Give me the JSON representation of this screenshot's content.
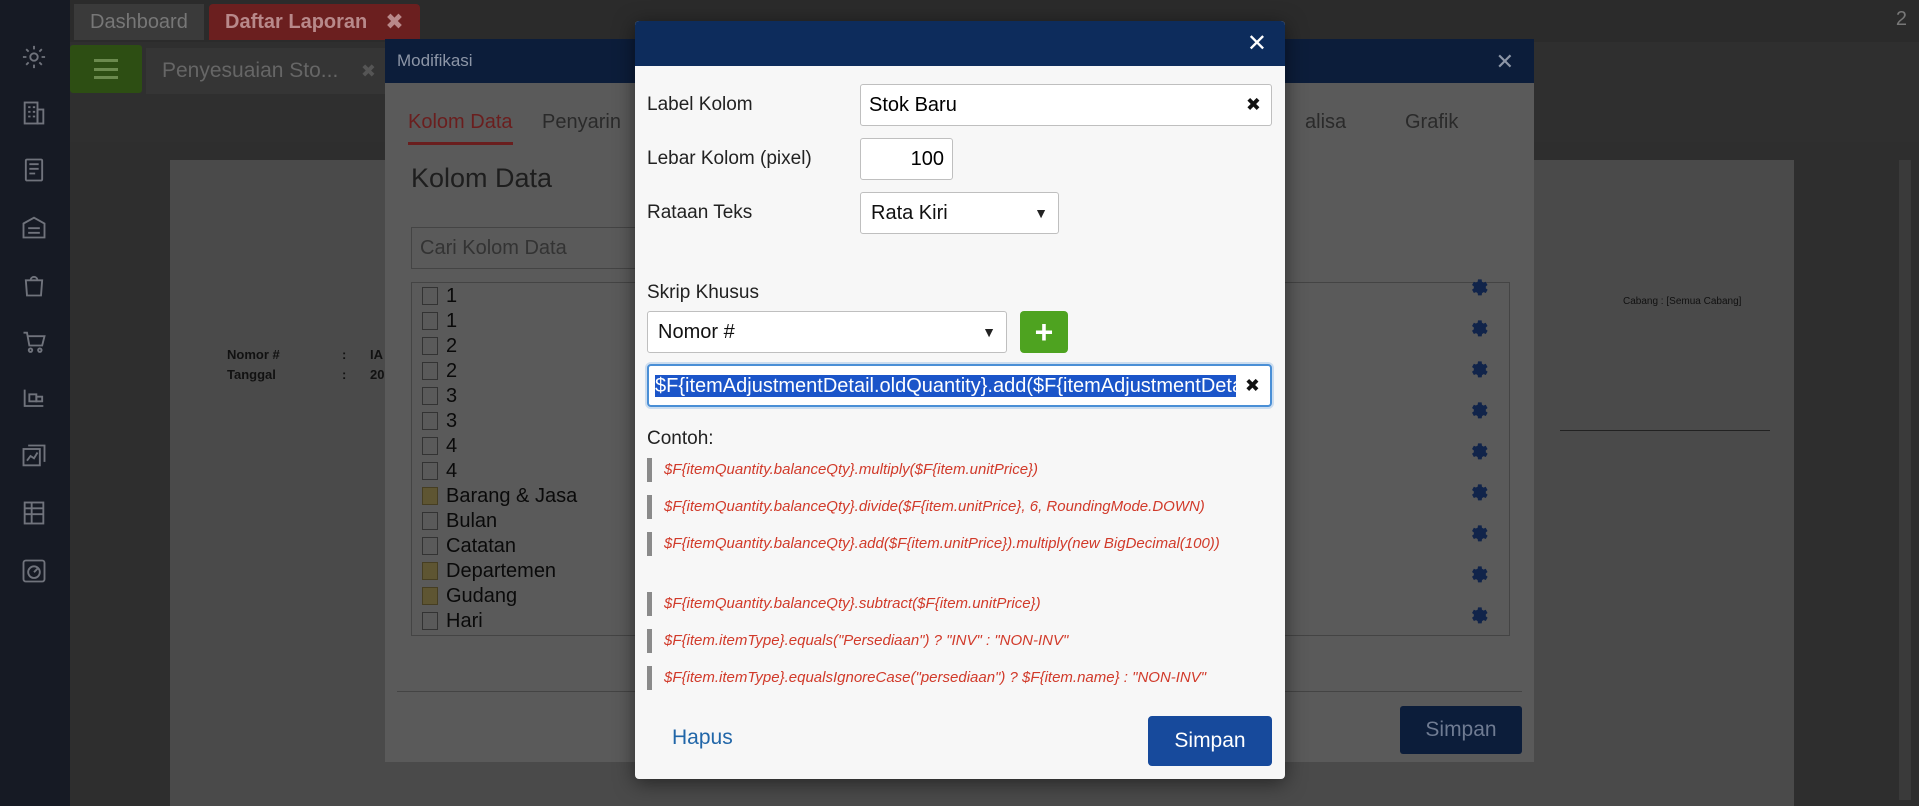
{
  "topbar": {
    "tab_dashboard": "Dashboard",
    "tab_laporan": "Daftar Laporan",
    "tab_laporan_close": "✖",
    "right_text": "2"
  },
  "page_tab": {
    "label": "Penyesuaian Sto...",
    "close": "✖"
  },
  "report_meta": [
    {
      "label": "Nomor #",
      "sep": ":",
      "value": "IA"
    },
    {
      "label": "Tanggal",
      "sep": ":",
      "value": "20"
    },
    {
      "label": "Cabang : [Semua Cabang]"
    }
  ],
  "modifikasi": {
    "title": "Modifikasi",
    "close": "✕",
    "tabs": [
      "Kolom Data",
      "Penyarin",
      "alisa",
      "Grafik"
    ],
    "section_title": "Kolom Data",
    "search_placeholder": "Cari Kolom Data",
    "tree": [
      {
        "label": "1",
        "type": "file"
      },
      {
        "label": "1",
        "type": "file"
      },
      {
        "label": "2",
        "type": "file"
      },
      {
        "label": "2",
        "type": "file"
      },
      {
        "label": "3",
        "type": "file"
      },
      {
        "label": "3",
        "type": "file"
      },
      {
        "label": "4",
        "type": "file"
      },
      {
        "label": "4",
        "type": "file"
      },
      {
        "label": "Barang & Jasa",
        "type": "folder"
      },
      {
        "label": "Bulan",
        "type": "file"
      },
      {
        "label": "Catatan",
        "type": "file"
      },
      {
        "label": "Departemen",
        "type": "folder"
      },
      {
        "label": "Gudang",
        "type": "folder"
      },
      {
        "label": "Hari",
        "type": "file"
      }
    ],
    "save_label": "Simpan"
  },
  "dialog": {
    "close": "✕",
    "label_kolom": {
      "label": "Label Kolom",
      "value": "Stok Baru",
      "clear": "✖"
    },
    "lebar_kolom": {
      "label": "Lebar Kolom (pixel)",
      "value": "100"
    },
    "rataan_teks": {
      "label": "Rataan Teks",
      "selected": "Rata Kiri"
    },
    "skrip_khusus": {
      "label": "Skrip Khusus",
      "selected": "Nomor #",
      "add": "+",
      "value": "$F{itemAdjustmentDetail.oldQuantity}.add($F{itemAdjustmentDetail.newQuantity})",
      "clear": "✖"
    },
    "examples_title": "Contoh:",
    "examples": [
      "$F{itemQuantity.balanceQty}.multiply($F{item.unitPrice})",
      "$F{itemQuantity.balanceQty}.divide($F{item.unitPrice}, 6, RoundingMode.DOWN)",
      "$F{itemQuantity.balanceQty}.add($F{item.unitPrice}).multiply(new BigDecimal(100))",
      "$F{itemQuantity.balanceQty}.subtract($F{item.unitPrice})",
      "$F{item.itemType}.equals(\"Persediaan\") ? \"INV\" : \"NON-INV\"",
      "$F{item.itemType}.equalsIgnoreCase(\"persediaan\") ? $F{item.name} : \"NON-INV\""
    ],
    "delete_label": "Hapus",
    "save_label": "Simpan"
  },
  "colors": {
    "dialog_header": "#0d2c5c",
    "save_button": "#174a9c",
    "add_button": "#4ea320",
    "example_text": "#d13a2a",
    "delete_link": "#2166a8",
    "selection": "#1b55c9"
  }
}
